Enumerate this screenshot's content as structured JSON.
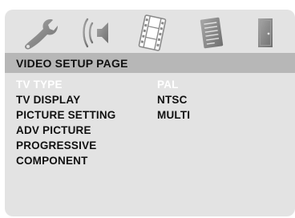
{
  "icon_bar": {
    "icons": [
      {
        "name": "wrench-icon",
        "selected": false
      },
      {
        "name": "speaker-icon",
        "selected": false
      },
      {
        "name": "film-icon",
        "selected": true
      },
      {
        "name": "document-icon",
        "selected": false
      },
      {
        "name": "door-icon",
        "selected": false
      }
    ]
  },
  "page_title": "VIDEO SETUP PAGE",
  "menu": {
    "items": [
      {
        "label": "TV TYPE",
        "highlighted": true
      },
      {
        "label": "TV DISPLAY",
        "highlighted": false
      },
      {
        "label": "PICTURE SETTING",
        "highlighted": false
      },
      {
        "label": "ADV PICTURE",
        "highlighted": false
      },
      {
        "label": "PROGRESSIVE",
        "highlighted": false
      },
      {
        "label": "COMPONENT",
        "highlighted": false
      }
    ]
  },
  "options": {
    "items": [
      {
        "label": "PAL",
        "highlighted": true
      },
      {
        "label": "NTSC",
        "highlighted": false
      },
      {
        "label": "MULTI",
        "highlighted": false
      }
    ]
  },
  "colors": {
    "background": "#e3e3e3",
    "title_bar": "#b7b7b7",
    "text": "#111111",
    "highlight_text": "#ffffff",
    "icon_gray": "#8a8a8a",
    "selected_icon_fill": "#ffffff"
  }
}
